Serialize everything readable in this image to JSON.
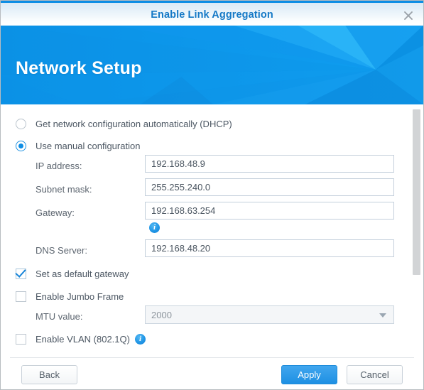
{
  "titlebar": {
    "title": "Enable Link Aggregation",
    "close_icon": "close-icon"
  },
  "banner": {
    "heading": "Network Setup"
  },
  "form": {
    "ip_mode": {
      "selected": "manual",
      "options": [
        {
          "id": "dhcp",
          "label": "Get network configuration automatically (DHCP)",
          "checked": false
        },
        {
          "id": "manual",
          "label": "Use manual configuration",
          "checked": true
        }
      ]
    },
    "fields": [
      {
        "id": "ip-address",
        "label": "IP address:",
        "value": "192.168.48.9",
        "placeholder": ""
      },
      {
        "id": "subnet-mask",
        "label": "Subnet mask:",
        "value": "255.255.240.0",
        "placeholder": ""
      },
      {
        "id": "gateway",
        "label": "Gateway:",
        "value": "192.168.63.254",
        "placeholder": ""
      },
      {
        "id": "dns-server",
        "label": "DNS Server:",
        "value": "192.168.48.20",
        "placeholder": ""
      }
    ],
    "gateway_info_icon": "info-icon",
    "checkboxes": [
      {
        "id": "default-gateway",
        "label": "Set as default gateway",
        "checked": true
      },
      {
        "id": "jumbo-frame",
        "label": "Enable Jumbo Frame",
        "checked": false
      },
      {
        "id": "vlan",
        "label": "Enable VLAN (802.1Q)",
        "checked": false
      }
    ],
    "vlan_info_icon": "info-icon",
    "mtu": {
      "label": "MTU value:",
      "value": "2000",
      "disabled": true,
      "arrow_icon": "chevron-down-icon"
    }
  },
  "footer": {
    "back": "Back",
    "apply": "Apply",
    "cancel": "Cancel"
  },
  "colors": {
    "accent_blue": "#0d8de4",
    "title_blue": "#1579c6",
    "banner_blue": "#0e97e8",
    "text_gray": "#4c5763",
    "border_gray": "#c3cfdb"
  }
}
